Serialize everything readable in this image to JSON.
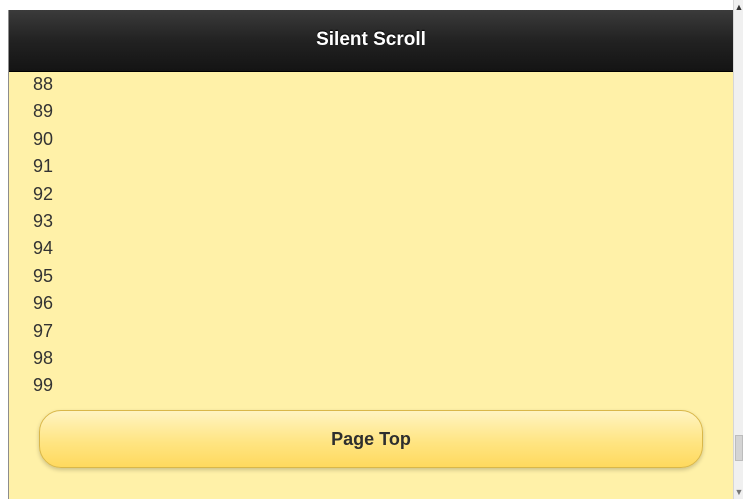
{
  "header": {
    "title": "Silent Scroll"
  },
  "list": {
    "items": [
      "88",
      "89",
      "90",
      "91",
      "92",
      "93",
      "94",
      "95",
      "96",
      "97",
      "98",
      "99"
    ]
  },
  "button": {
    "label": "Page Top"
  },
  "scrollbar": {
    "up_glyph": "▲",
    "down_glyph": "▼"
  },
  "colors": {
    "header_bg": "#1f1f1f",
    "content_bg": "#fff1a8",
    "button_bg": "#ffe583"
  }
}
